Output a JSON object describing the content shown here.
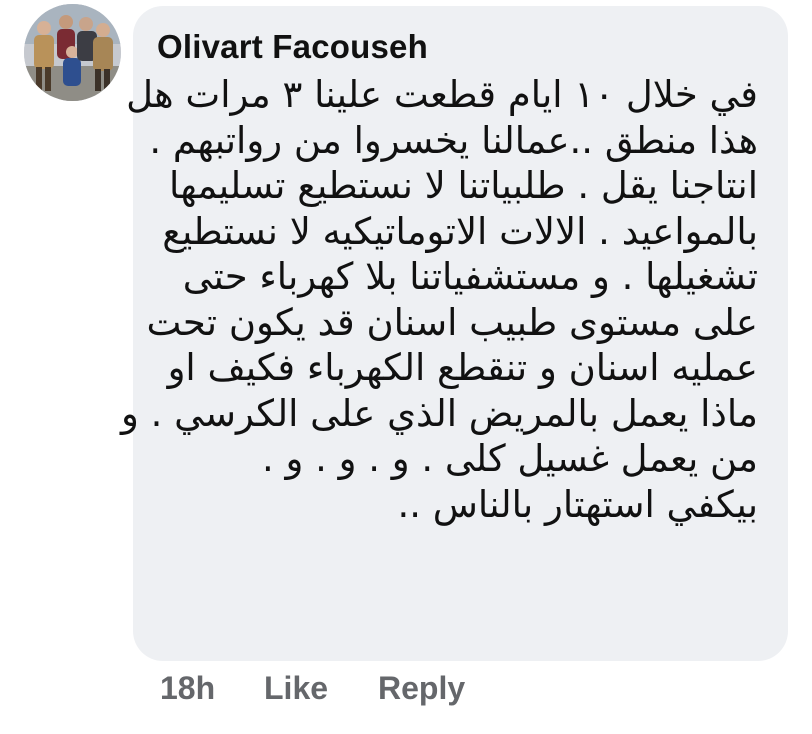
{
  "comment": {
    "author": "Olivart Facouseh",
    "lines": [
      "في خلال ١٠ ايام قطعت علينا ٣ مرات هل",
      "هذا منطق ..عمالنا يخسروا من رواتبهم .",
      "انتاجنا يقل . طلبياتنا لا نستطيع تسليمها",
      "بالمواعيد . الالات الاتوماتيكيه لا نستطيع",
      "تشغيلها .  و مستشفياتنا بلا كهرباء حتى",
      "على مستوى طبيب اسنان قد يكون تحت",
      "عمليه اسنان و تنقطع الكهرباء فكيف او",
      "ماذا يعمل بالمريض الذي على الكرسي . و",
      "من يعمل غسيل كلى . و . و . و .",
      "بيكفي استهتار بالناس .."
    ]
  },
  "actions": {
    "time": "18h",
    "like": "Like",
    "reply": "Reply"
  },
  "icons": {
    "avatar": "profile-photo-avatar"
  },
  "colors": {
    "bubble_background": "#eef0f3",
    "text": "#111111",
    "action_text": "#65676b"
  }
}
